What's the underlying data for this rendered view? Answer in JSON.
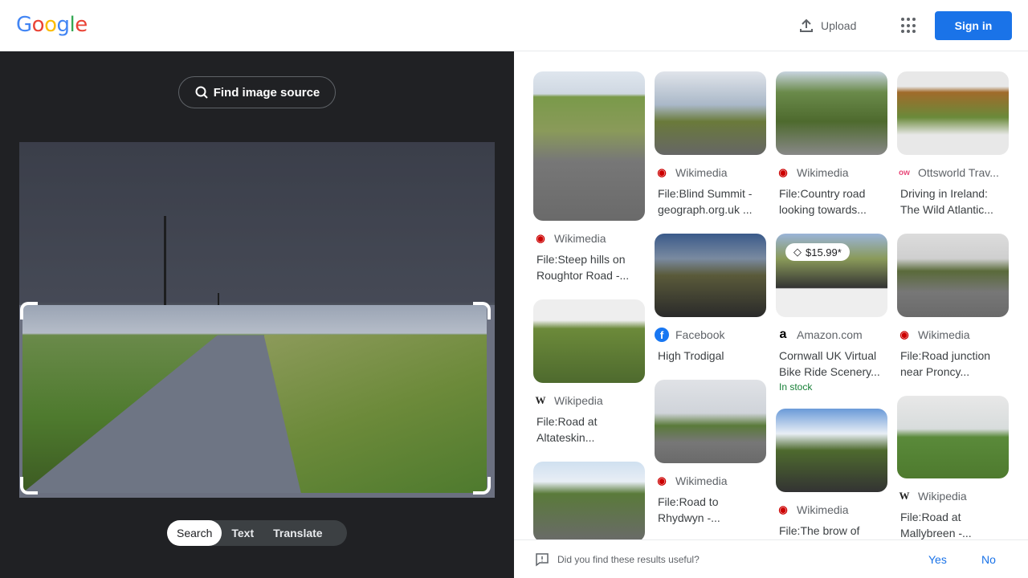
{
  "header": {
    "logo": "Google",
    "upload_label": "Upload",
    "signin_label": "Sign in"
  },
  "left": {
    "find_source_label": "Find image source",
    "tabs": [
      "Search",
      "Text",
      "Translate"
    ],
    "active_tab": "Search"
  },
  "results": [
    {
      "source": "Wikimedia",
      "icon": "wikimedia-icon",
      "title": "File:Steep hills on Roughtor Road -..."
    },
    {
      "source": "Wikipedia",
      "icon": "wikipedia-icon",
      "title": "File:Road at Altateskin..."
    },
    {
      "source": "Wikimedia",
      "icon": "wikimedia-icon",
      "title": "File:Blind Summit - geograph.org.uk ..."
    },
    {
      "source": "Facebook",
      "icon": "facebook-icon",
      "title": "High Trodigal"
    },
    {
      "source": "Wikimedia",
      "icon": "wikimedia-icon",
      "title": "File:Road to Rhydwyn -..."
    },
    {
      "source": "Wikimedia",
      "icon": "wikimedia-icon",
      "title": "File:Country road looking towards..."
    },
    {
      "source": "Amazon.com",
      "icon": "amazon-icon",
      "title": "Cornwall UK Virtual Bike Ride Scenery...",
      "price": "$15.99*",
      "stock": "In stock"
    },
    {
      "source": "Wikimedia",
      "icon": "wikimedia-icon",
      "title": "File:The brow of"
    },
    {
      "source": "Ottsworld Trav...",
      "icon": "ottsworld-icon",
      "title": "Driving in Ireland: The Wild Atlantic..."
    },
    {
      "source": "Wikimedia",
      "icon": "wikimedia-icon",
      "title": "File:Road junction near Proncy..."
    },
    {
      "source": "Wikipedia",
      "icon": "wikipedia-icon",
      "title": "File:Road at Mallybreen -..."
    }
  ],
  "feedback": {
    "question": "Did you find these results useful?",
    "yes": "Yes",
    "no": "No"
  },
  "colors": {
    "accent": "#1a73e8",
    "dark_panel": "#202124",
    "in_stock": "#188038"
  }
}
